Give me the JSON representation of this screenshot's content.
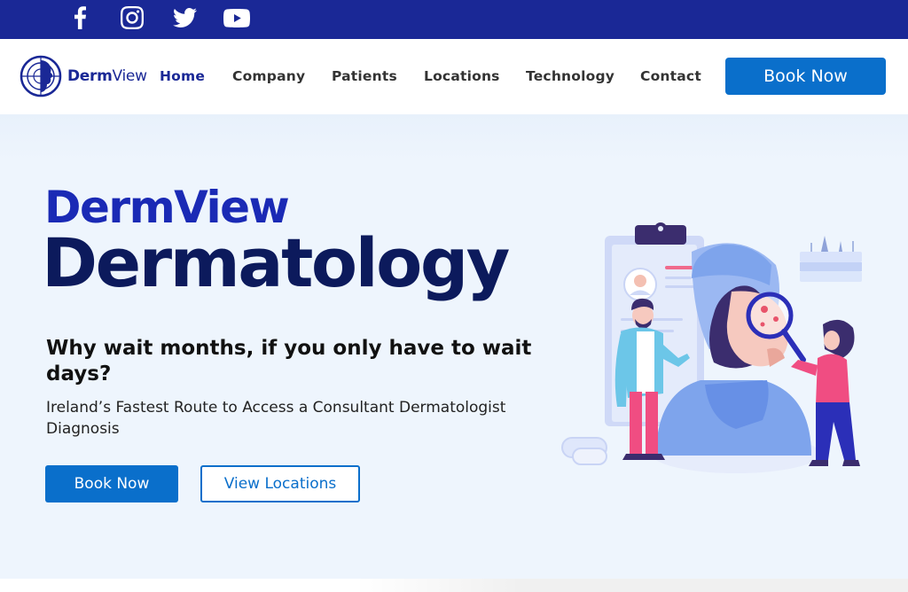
{
  "social": {
    "items": [
      {
        "name": "facebook",
        "icon": "facebook-icon"
      },
      {
        "name": "instagram",
        "icon": "instagram-icon"
      },
      {
        "name": "twitter",
        "icon": "twitter-icon"
      },
      {
        "name": "youtube",
        "icon": "youtube-icon"
      }
    ]
  },
  "header": {
    "logo": {
      "part1": "Derm",
      "part2": "View"
    },
    "nav": [
      "Home",
      "Company",
      "Patients",
      "Locations",
      "Technology",
      "Contact"
    ],
    "active": "Home",
    "cta": "Book Now"
  },
  "hero": {
    "brand": "DermView",
    "title": "Dermatology",
    "heading": "Why wait months, if you only have to wait days?",
    "subheading": "Ireland’s Fastest Route to Access a Consultant Dermatologist Diagnosis",
    "primary_button": "Book Now",
    "secondary_button": "View Locations"
  },
  "colors": {
    "brand_blue": "#1a2896",
    "button_blue": "#0a6fcb",
    "title_navy": "#0c1a5c",
    "hero_bg": "#eef5fd"
  }
}
